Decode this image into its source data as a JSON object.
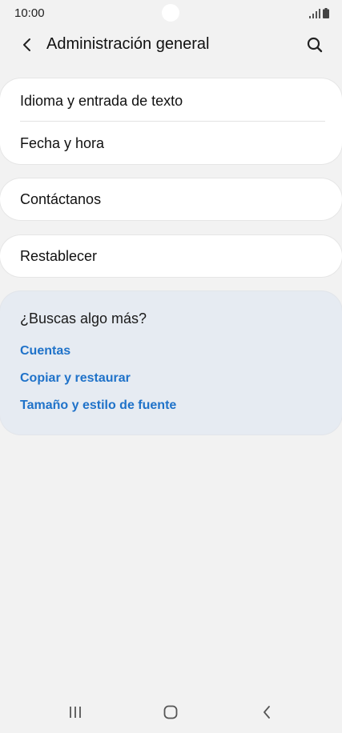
{
  "status_bar": {
    "time": "10:00",
    "icons": [
      "signal-icon",
      "battery-icon"
    ]
  },
  "header": {
    "title": "Administración general",
    "back_icon": "chevron-left-icon",
    "search_icon": "search-icon"
  },
  "settings_groups": [
    {
      "items": [
        {
          "label": "Idioma y entrada de texto"
        },
        {
          "label": "Fecha y hora"
        }
      ]
    },
    {
      "items": [
        {
          "label": "Contáctanos"
        }
      ]
    },
    {
      "items": [
        {
          "label": "Restablecer"
        }
      ]
    }
  ],
  "suggestions": {
    "title": "¿Buscas algo más?",
    "links": [
      {
        "label": "Cuentas"
      },
      {
        "label": "Copiar y restaurar"
      },
      {
        "label": "Tamaño y estilo de fuente"
      }
    ]
  },
  "nav_bar": {
    "icons": [
      "recent-apps-icon",
      "home-icon",
      "back-icon"
    ]
  },
  "colors": {
    "background": "#f2f2f2",
    "card": "#ffffff",
    "suggestion_panel": "#e6ebf2",
    "link": "#1f72c9"
  }
}
